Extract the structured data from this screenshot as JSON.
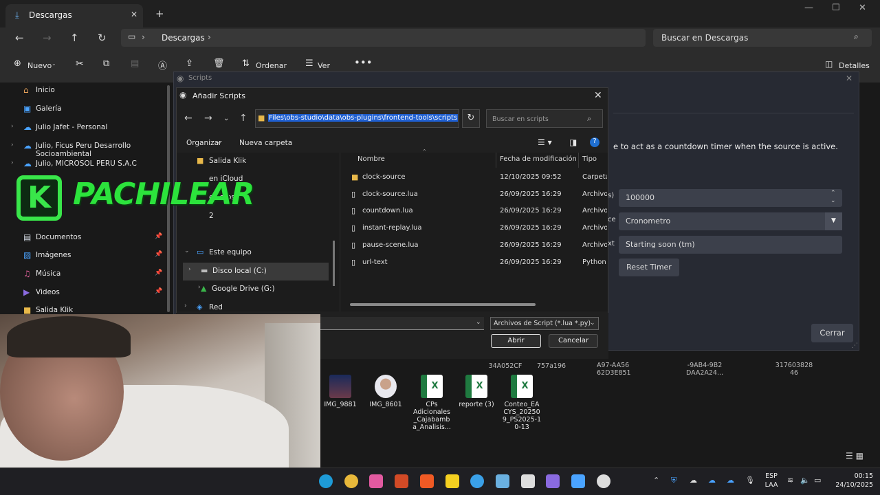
{
  "explorer": {
    "tab_title": "Descargas",
    "breadcrumb": "Descargas",
    "search_placeholder": "Buscar en Descargas",
    "toolbar": {
      "new": "Nuevo",
      "sort": "Ordenar",
      "view": "Ver",
      "details": "Detalles"
    },
    "nav_items": [
      {
        "label": "Inicio",
        "icon": "home-icon"
      },
      {
        "label": "Galería",
        "icon": "gallery-icon"
      },
      {
        "label": "Julio Jafet - Personal",
        "icon": "cloud-icon"
      },
      {
        "label": "Julio, Ficus Peru Desarrollo Socioambiental",
        "icon": "cloud-icon"
      },
      {
        "label": "Julio, MICROSOL PERU S.A.C",
        "icon": "cloud-icon"
      },
      {
        "label": "Documentos",
        "icon": "documents-icon"
      },
      {
        "label": "Imágenes",
        "icon": "pictures-icon"
      },
      {
        "label": "Música",
        "icon": "music-icon"
      },
      {
        "label": "Videos",
        "icon": "videos-icon"
      },
      {
        "label": "Salida Klik",
        "icon": "folder-icon"
      }
    ]
  },
  "scripts_window": {
    "title": "Scripts",
    "description": "e to act as a countdown timer when the source is active.",
    "fields": [
      {
        "label": "s)",
        "value": "100000"
      },
      {
        "label": "ce",
        "value": "Cronometro"
      },
      {
        "label": "xt",
        "value": "Starting soon (tm)"
      }
    ],
    "reset_button": "Reset Timer",
    "close_button": "Cerrar"
  },
  "dialog": {
    "title": "Añadir Scripts",
    "path": "Files\\obs-studio\\data\\obs-plugins\\frontend-tools\\scripts",
    "search_placeholder": "Buscar en scripts",
    "organize": "Organizar",
    "new_folder": "Nueva carpeta",
    "left_items": [
      {
        "label": "Salida Klik",
        "icon": "folder-icon",
        "chevron": ""
      },
      {
        "label": "en iCloud",
        "icon": "",
        "chevron": ""
      },
      {
        "label": "e Fotos",
        "icon": "",
        "chevron": ""
      },
      {
        "label": "2",
        "icon": "",
        "chevron": ""
      },
      {
        "label": "Este equipo",
        "icon": "computer-icon",
        "chevron": "⌄"
      },
      {
        "label": "Disco local (C:)",
        "icon": "drive-icon",
        "chevron": "›"
      },
      {
        "label": "Google Drive (G:)",
        "icon": "google-drive-icon",
        "chevron": "›"
      },
      {
        "label": "Red",
        "icon": "network-icon",
        "chevron": "›"
      }
    ],
    "columns": {
      "name": "Nombre",
      "modified": "Fecha de modificación",
      "type": "Tipo"
    },
    "files": [
      {
        "name": "clock-source",
        "date": "12/10/2025 09:52",
        "type": "Carpeta",
        "icon": "folder-icon"
      },
      {
        "name": "clock-source.lua",
        "date": "26/09/2025 16:29",
        "type": "Archivo",
        "icon": "file-icon"
      },
      {
        "name": "countdown.lua",
        "date": "26/09/2025 16:29",
        "type": "Archivo l",
        "icon": "file-icon"
      },
      {
        "name": "instant-replay.lua",
        "date": "26/09/2025 16:29",
        "type": "Archivo l",
        "icon": "file-icon"
      },
      {
        "name": "pause-scene.lua",
        "date": "26/09/2025 16:29",
        "type": "Archivo l",
        "icon": "file-icon"
      },
      {
        "name": "url-text",
        "date": "26/09/2025 16:29",
        "type": "Python F",
        "icon": "python-file-icon"
      }
    ],
    "file_type": "Archivos de Script (*.lua *.py)",
    "open_button": "Abrir",
    "cancel_button": "Cancelar"
  },
  "logo_text": "PACHILEAR",
  "background_files": {
    "hash_fragments": [
      {
        "lines": [
          "34A052CF"
        ]
      },
      {
        "lines": [
          "757a196"
        ]
      },
      {
        "lines": [
          "A97-AA56",
          "62D3E851"
        ]
      },
      {
        "lines": [
          "-9AB4-9B2",
          "DAA2A24..."
        ]
      },
      {
        "lines": [
          "317603828",
          "46"
        ]
      }
    ],
    "icons": [
      {
        "label": "IMG_9881",
        "kind": "photo"
      },
      {
        "label": "IMG_8601",
        "kind": "photo"
      },
      {
        "label": "CPs Adicionales _Cajabamb a_Analisis...",
        "kind": "excel"
      },
      {
        "label": "reporte (3)",
        "kind": "excel"
      },
      {
        "label": "Conteo_EA CYS_20250 9_PS2025-1 0-13",
        "kind": "excel"
      }
    ]
  },
  "taskbar": {
    "language": [
      "ESP",
      "LAA"
    ],
    "time": "00:15",
    "date": "24/10/2025"
  },
  "colors": {
    "accent": "#1f5fd1",
    "logo_green": "#39e64a"
  }
}
